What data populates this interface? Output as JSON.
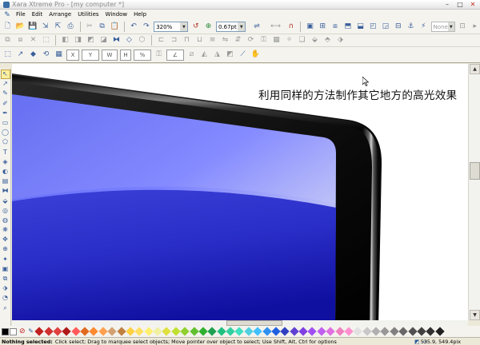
{
  "window": {
    "title": "Xara Xtreme Pro - [my computer *]",
    "min_glyph": "–",
    "max_glyph": "□",
    "close_glyph": "✕"
  },
  "menu": {
    "items": [
      {
        "label": "File",
        "name": "menu-file"
      },
      {
        "label": "Edit",
        "name": "menu-edit"
      },
      {
        "label": "Arrange",
        "name": "menu-arrange"
      },
      {
        "label": "Utilities",
        "name": "menu-utilities"
      },
      {
        "label": "Window",
        "name": "menu-window"
      },
      {
        "label": "Help",
        "name": "menu-help"
      }
    ]
  },
  "toolbar": {
    "zoom_value": "320%",
    "line_width": "0.67pt",
    "dropdown_arrow": "▼",
    "transparency_value": "None"
  },
  "canvas": {
    "annotation": "利用同样的方法制作其它地方的高光效果"
  },
  "status": {
    "bold": "Nothing selected:",
    "message": "Click select; Drag to marquee select objects; Move pointer over object to select; Use Shift, Alt, Ctrl for options",
    "coords": "535.9, 549.4pix"
  },
  "palette": {
    "no_color_glyph": "⊘",
    "swatches": [
      "#000000",
      "#ffffff"
    ],
    "diamonds": [
      "#c02020",
      "#d03030",
      "#e04040",
      "#b01818",
      "#ff5a5a",
      "#e06a20",
      "#ff8a30",
      "#ffa050",
      "#d4a070",
      "#c08040",
      "#ffd040",
      "#ffe060",
      "#fff070",
      "#f0f0a0",
      "#e0e040",
      "#c0e030",
      "#90d030",
      "#60c030",
      "#30b030",
      "#20a050",
      "#20c080",
      "#30d0a0",
      "#40e0c0",
      "#50d0e0",
      "#40c0ff",
      "#3090f0",
      "#2060e0",
      "#3040c0",
      "#6040d0",
      "#8040e0",
      "#a050f0",
      "#c060f0",
      "#e070e0",
      "#f080c0",
      "#ff90d0",
      "#e0e0e0",
      "#c8c8c8",
      "#b0b0b0",
      "#989898",
      "#808080",
      "#686868",
      "#505050",
      "#404040",
      "#303030",
      "#202020"
    ]
  }
}
